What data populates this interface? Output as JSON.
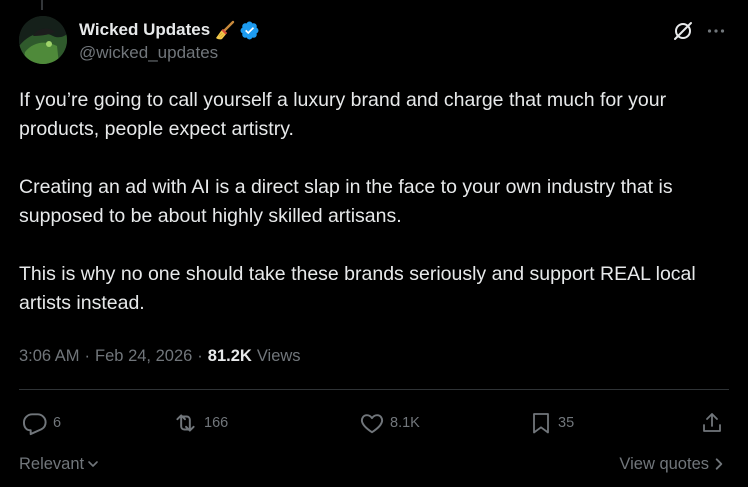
{
  "author": {
    "display_name": "Wicked Updates",
    "handle": "@wicked_updates",
    "name_emoji": "broom-icon",
    "verified_icon": "verified-badge-icon",
    "verified_color": "#1d9bf0"
  },
  "tweet": {
    "paragraphs": [
      "If you’re going to call yourself a luxury brand and charge that much for your products, people expect artistry.",
      "Creating an ad with AI is a direct slap in the face to your own industry that is supposed to be about highly skilled artisans.",
      "This is why no one should take these brands seriously and support REAL local artists instead."
    ],
    "time": "3:06 AM",
    "date": "Feb 24, 2026",
    "separator": "·",
    "views_count": "81.2K",
    "views_label": "Views"
  },
  "actions": {
    "replies": "6",
    "reposts": "166",
    "likes": "8.1K",
    "bookmarks": "35"
  },
  "footer": {
    "sort_label": "Relevant",
    "view_quotes_label": "View quotes"
  },
  "colors": {
    "background": "#000000",
    "text": "#e7e9ea",
    "muted": "#71767b",
    "divider": "#2f3336"
  }
}
